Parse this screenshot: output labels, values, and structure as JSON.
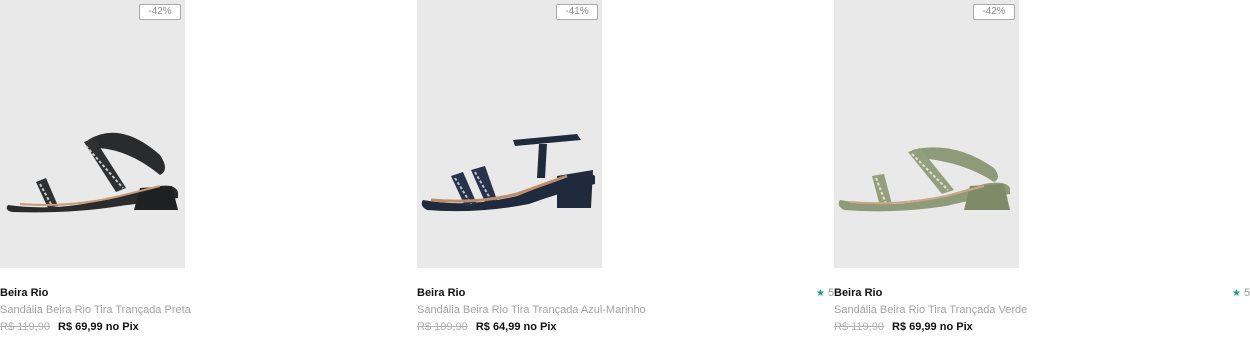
{
  "products": [
    {
      "discount": "-42%",
      "brand": "Beira Rio",
      "name": "Sandália Beira Rio Tira Trançada Preta",
      "old_price": "R$ 119,90",
      "new_price": "R$ 69,99",
      "pix_label": "no Pix",
      "color": "#2a2b2d",
      "image_icon": "black-sandal-image"
    },
    {
      "discount": "-41%",
      "brand": "Beira Rio",
      "name": "Sandália Beira Rio Tira Trançada Azul-Marinho",
      "old_price": "R$ 109,90",
      "new_price": "R$ 64,99",
      "pix_label": "no Pix",
      "color": "#1f2a3c",
      "image_icon": "navy-sandal-image",
      "rating": {
        "star": "★",
        "value": "5"
      }
    },
    {
      "discount": "-42%",
      "brand": "Beira Rio",
      "name": "Sandália Beira Rio Tira Trançada Verde",
      "old_price": "R$ 119,90",
      "new_price": "R$ 69,99",
      "pix_label": "no Pix",
      "color": "#8f9a78",
      "image_icon": "green-sandal-image",
      "rating": {
        "star": "★",
        "value": "5"
      }
    }
  ],
  "colors": {
    "photo_bg": "#e9e9e9",
    "rating_star": "#1f9b8c",
    "muted_text": "#a3a3a3"
  }
}
